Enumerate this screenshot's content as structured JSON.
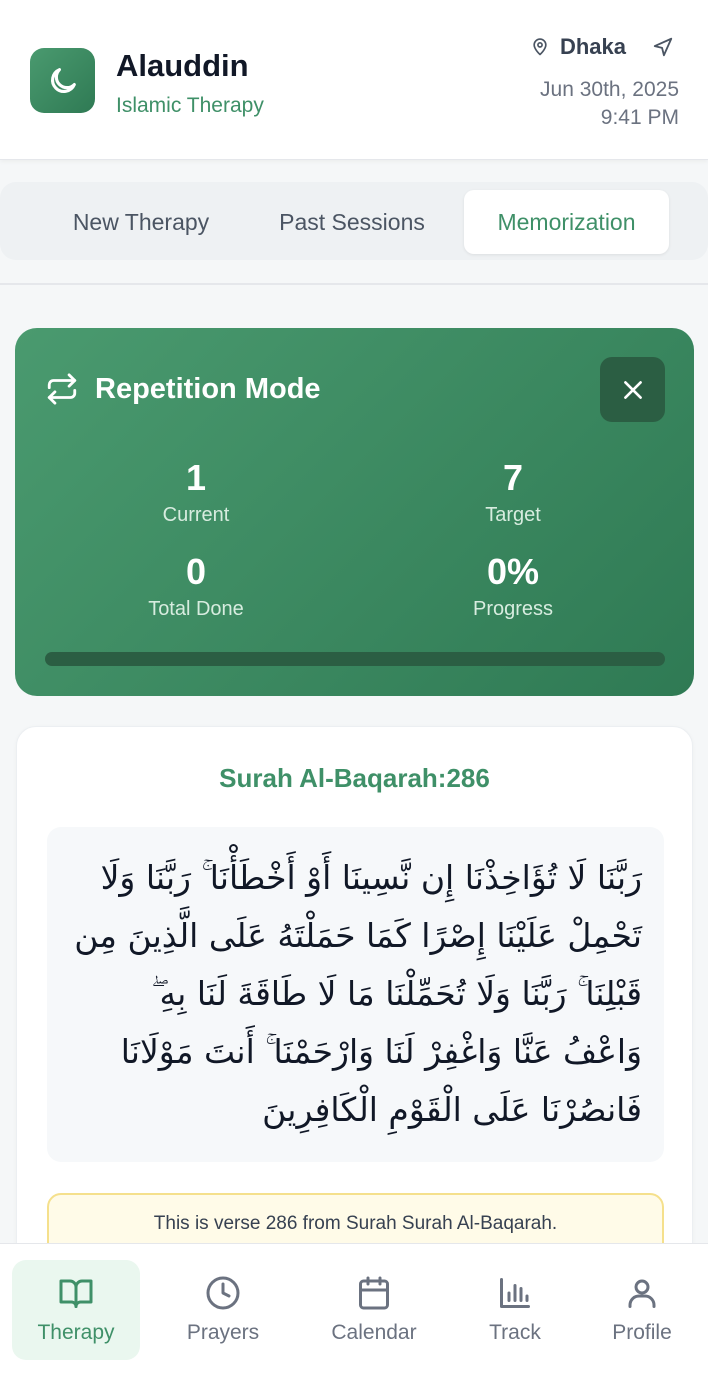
{
  "header": {
    "app_name": "Alauddin",
    "app_subtitle": "Islamic Therapy",
    "location": "Dhaka",
    "date": "Jun 30th, 2025",
    "time": "9:41 PM"
  },
  "tabs": [
    {
      "label": "New Therapy",
      "active": false
    },
    {
      "label": "Past Sessions",
      "active": false
    },
    {
      "label": "Memorization",
      "active": true
    }
  ],
  "repetition": {
    "title": "Repetition Mode",
    "current_value": "1",
    "current_label": "Current",
    "target_value": "7",
    "target_label": "Target",
    "total_value": "0",
    "total_label": "Total Done",
    "progress_value": "0%",
    "progress_label": "Progress",
    "progress_fraction": 0
  },
  "verse": {
    "reference": "Surah Al-Baqarah:286",
    "arabic": "رَبَّنَا لَا تُؤَاخِذْنَا إِن نَّسِينَا أَوْ أَخْطَأْنَا ۚ رَبَّنَا وَلَا تَحْمِلْ عَلَيْنَا إِصْرًا كَمَا حَمَلْتَهُ عَلَى الَّذِينَ مِن قَبْلِنَا ۚ رَبَّنَا وَلَا تُحَمِّلْنَا مَا لَا طَاقَةَ لَنَا بِهِ ۖ وَاعْفُ عَنَّا وَاغْفِرْ لَنَا وَارْحَمْنَا ۚ أَنتَ مَوْلَانَا فَانصُرْنَا عَلَى الْقَوْمِ الْكَافِرِينَ",
    "note": "This is verse 286 from Surah Surah Al-Baqarah."
  },
  "bottom_nav": [
    {
      "label": "Therapy",
      "icon": "book-icon",
      "active": true
    },
    {
      "label": "Prayers",
      "icon": "clock-icon",
      "active": false
    },
    {
      "label": "Calendar",
      "icon": "calendar-icon",
      "active": false
    },
    {
      "label": "Track",
      "icon": "bar-chart-icon",
      "active": false
    },
    {
      "label": "Profile",
      "icon": "user-icon",
      "active": false
    }
  ],
  "colors": {
    "brand_green": "#3f9068",
    "card_gradient_start": "#4a9a6f",
    "card_gradient_end": "#2f7a54",
    "note_bg": "#fffbe8"
  }
}
